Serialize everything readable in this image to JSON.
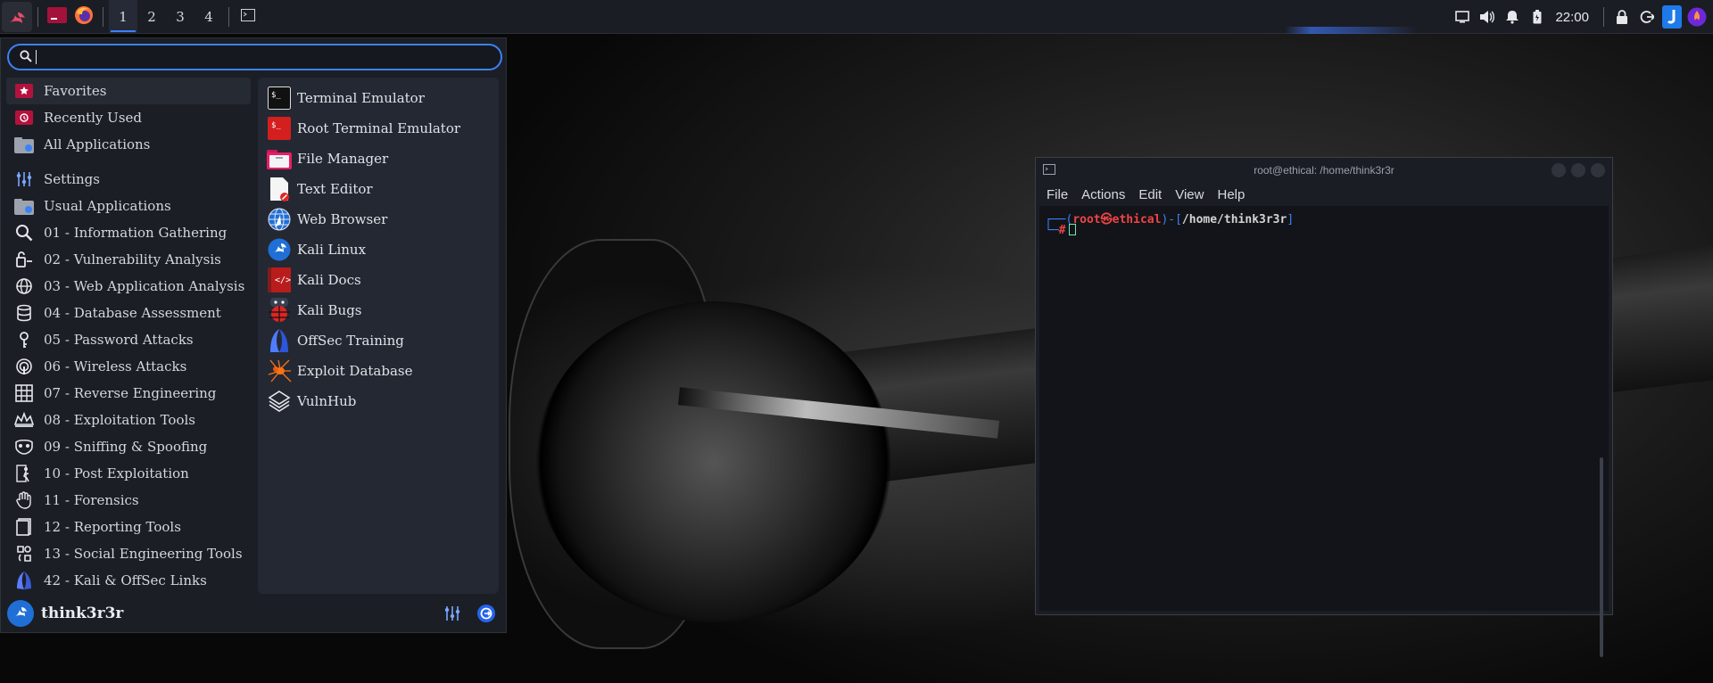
{
  "top_panel": {
    "workspaces": [
      "1",
      "2",
      "3",
      "4"
    ],
    "active_workspace": "1",
    "clock": "22:00",
    "accent_color": "#3b82f6"
  },
  "menu": {
    "search": {
      "value": "",
      "placeholder": ""
    },
    "categories": [
      {
        "label": "Favorites",
        "icon": "star-icon",
        "selected": true
      },
      {
        "label": "Recently Used",
        "icon": "clock-icon"
      },
      {
        "label": "All Applications",
        "icon": "apps-folder-icon"
      },
      {
        "label": "Settings",
        "icon": "settings-icon"
      },
      {
        "label": "Usual Applications",
        "icon": "folder-icon"
      },
      {
        "label": "01 - Information Gathering",
        "icon": "magnifier-icon"
      },
      {
        "label": "02 - Vulnerability Analysis",
        "icon": "vulnerability-icon"
      },
      {
        "label": "03 - Web Application Analysis",
        "icon": "globe-icon"
      },
      {
        "label": "04 - Database Assessment",
        "icon": "database-icon"
      },
      {
        "label": "05 - Password Attacks",
        "icon": "key-icon"
      },
      {
        "label": "06 - Wireless Attacks",
        "icon": "wireless-icon"
      },
      {
        "label": "07 - Reverse Engineering",
        "icon": "grid-icon"
      },
      {
        "label": "08 - Exploitation Tools",
        "icon": "crown-icon"
      },
      {
        "label": "09 - Sniffing & Spoofing",
        "icon": "mask-icon"
      },
      {
        "label": "10 - Post Exploitation",
        "icon": "runner-icon"
      },
      {
        "label": "11 - Forensics",
        "icon": "hand-icon"
      },
      {
        "label": "12 - Reporting Tools",
        "icon": "report-icon"
      },
      {
        "label": "13 - Social Engineering Tools",
        "icon": "social-icon"
      },
      {
        "label": "42 - Kali & OffSec Links",
        "icon": "kali-links-icon"
      }
    ],
    "apps": [
      {
        "label": "Terminal Emulator",
        "icon": "terminal-icon"
      },
      {
        "label": "Root Terminal Emulator",
        "icon": "root-terminal-icon"
      },
      {
        "label": "File Manager",
        "icon": "file-manager-icon"
      },
      {
        "label": "Text Editor",
        "icon": "text-editor-icon"
      },
      {
        "label": "Web Browser",
        "icon": "web-browser-icon"
      },
      {
        "label": "Kali Linux",
        "icon": "kali-dragon-icon"
      },
      {
        "label": "Kali Docs",
        "icon": "kali-docs-icon"
      },
      {
        "label": "Kali Bugs",
        "icon": "kali-bugs-icon"
      },
      {
        "label": "OffSec Training",
        "icon": "offsec-icon"
      },
      {
        "label": "Exploit Database",
        "icon": "exploit-db-icon"
      },
      {
        "label": "VulnHub",
        "icon": "vulnhub-icon"
      }
    ],
    "username": "think3r3r"
  },
  "terminal": {
    "title": "root@ethical: /home/think3r3r",
    "menu": [
      "File",
      "Actions",
      "Edit",
      "View",
      "Help"
    ],
    "prompt": {
      "user": "root",
      "host": "ethical",
      "path": "/home/think3r3r",
      "symbol": "#"
    }
  }
}
